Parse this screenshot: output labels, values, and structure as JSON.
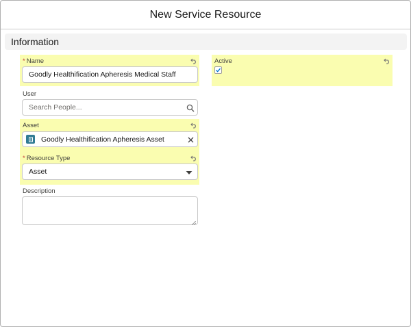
{
  "modal": {
    "title": "New Service Resource"
  },
  "section": {
    "title": "Information"
  },
  "fields": {
    "name": {
      "label": "Name",
      "required_mark": "*",
      "value": "Goodly Healthification Apheresis Medical Staff"
    },
    "active": {
      "label": "Active",
      "checked": true
    },
    "user": {
      "label": "User",
      "placeholder": "Search People..."
    },
    "asset": {
      "label": "Asset",
      "value": "Goodly Healthification Apheresis Asset"
    },
    "resource_type": {
      "label": "Resource Type",
      "required_mark": "*",
      "value": "Asset"
    },
    "description": {
      "label": "Description",
      "value": ""
    }
  },
  "icons": {
    "undo": "undo-icon",
    "search": "search-icon",
    "clear": "close-icon",
    "dropdown": "triangle-down-icon",
    "asset": "asset-object-icon",
    "check": "checkmark-icon"
  },
  "colors": {
    "highlight": "#fafdb0",
    "required": "#c23934",
    "asset_icon": "#317b94",
    "checkbox_check": "#0176d3"
  }
}
